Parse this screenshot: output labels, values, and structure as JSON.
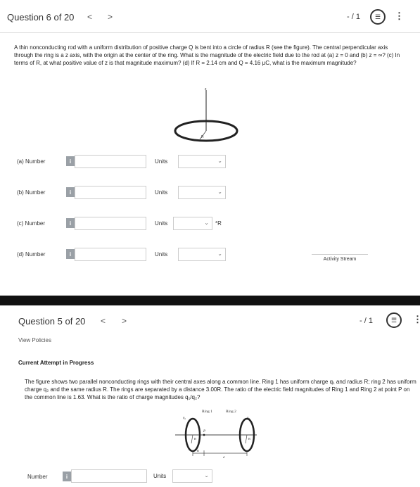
{
  "q6": {
    "title": "Question 6 of 20",
    "prev": "<",
    "next": ">",
    "score": "- / 1",
    "menu": "⋮",
    "problem": "A thin nonconducting rod with a uniform distribution of positive charge Q is bent into a circle of radius R (see the figure). The central perpendicular axis through the ring is a z axis, with the origin at the center of the ring. What is the magnitude of the electric field due to the rod at (a) z = 0 and (b) z = ∞? (c) In terms of R, at what positive value of z is that magnitude maximum? (d) If R = 2.14 cm and Q = 4.16 μC, what is the maximum magnitude?",
    "figure": {
      "z_label": "z",
      "r_label": "R"
    },
    "answers": [
      {
        "label": "(a)  Number",
        "units": "Units",
        "after": ""
      },
      {
        "label": "(b)  Number",
        "units": "Units",
        "after": ""
      },
      {
        "label": "(c)  Number",
        "units": "Units",
        "after": "*R"
      },
      {
        "label": "(d)  Number",
        "units": "Units",
        "after": ""
      }
    ],
    "info_icon": "i",
    "activity": "Activity Stream"
  },
  "q5": {
    "title": "Question 5 of 20",
    "prev": "<",
    "next": ">",
    "score": "- / 1",
    "menu": "⋮",
    "policies": "View Policies",
    "attempt": "Current Attempt in Progress",
    "problem": "The figure shows two parallel nonconducting rings with their central axes along a common line. Ring 1 has uniform charge q₁ and radius R; ring 2 has uniform charge q₂ and the same radius R. The rings are separated by a distance 3.00R. The ratio of the electric field magnitudes of Ring 1 and Ring 2 at point P on the common line is 1.63. What is the ratio of charge magnitudes q₁/q₂?",
    "figure": {
      "ring1": "Ring 1",
      "ring2": "Ring 2",
      "q1": "q₁",
      "q2": "q₂",
      "p": "P",
      "r1": "R",
      "r2": "R",
      "dim_r": "R",
      "dim_d": "d"
    },
    "answer": {
      "label": "Number",
      "units": "Units"
    },
    "info_icon": "i"
  },
  "icons": [
    "list-icon",
    "more-vertical-icon",
    "info-icon",
    "chevron-down-icon",
    "chevron-left-icon",
    "chevron-right-icon"
  ],
  "colors": {
    "info_button": "#9aa0a6",
    "divider_bar": "#111111"
  }
}
